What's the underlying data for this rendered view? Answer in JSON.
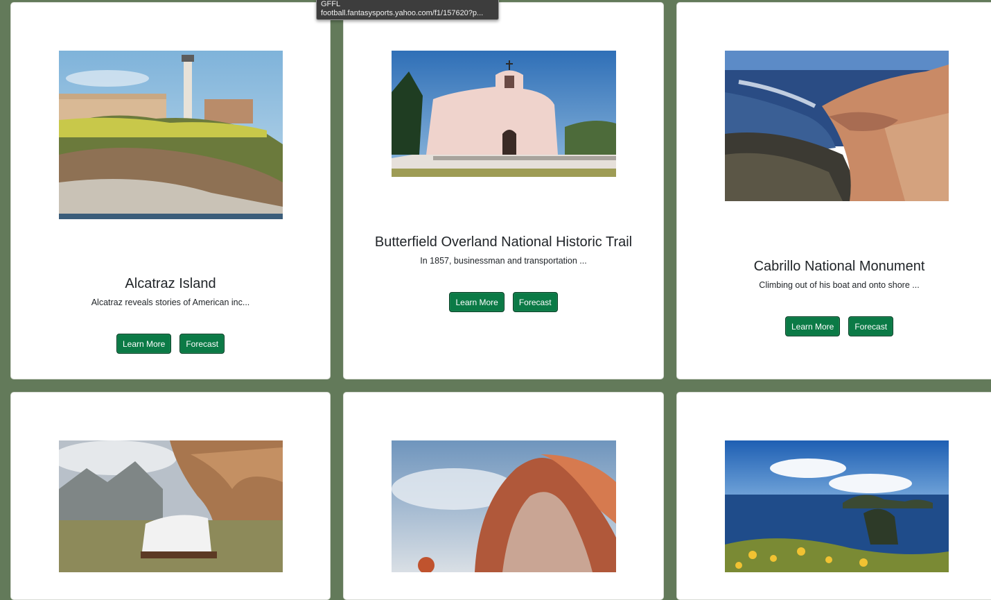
{
  "tooltip": {
    "title": "GFFL",
    "url": "football.fantasysports.yahoo.com/f1/157620?p..."
  },
  "parks": [
    {
      "name": "Alcatraz Island",
      "description": "Alcatraz reveals stories of American inc...",
      "learn_more": "Learn More",
      "forecast": "Forecast"
    },
    {
      "name": "Butterfield Overland National Historic Trail",
      "description": "In 1857, businessman and transportation ...",
      "learn_more": "Learn More",
      "forecast": "Forecast"
    },
    {
      "name": "Cabrillo National Monument",
      "description": "Climbing out of his boat and onto shore ...",
      "learn_more": "Learn More",
      "forecast": "Forecast"
    }
  ],
  "colors": {
    "background": "#637a5a",
    "button": "#0b7a46"
  }
}
